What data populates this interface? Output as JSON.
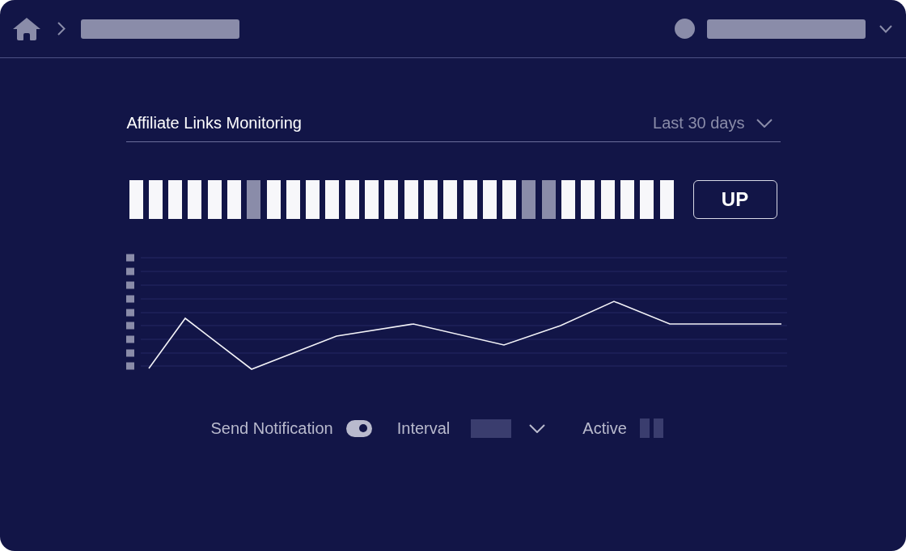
{
  "panel": {
    "title": "Affiliate Links Monitoring",
    "period": "Last 30 days"
  },
  "uptime_bars": [
    {
      "up": true
    },
    {
      "up": true
    },
    {
      "up": true
    },
    {
      "up": true
    },
    {
      "up": true
    },
    {
      "up": true
    },
    {
      "up": false
    },
    {
      "up": true
    },
    {
      "up": true
    },
    {
      "up": true
    },
    {
      "up": true
    },
    {
      "up": true
    },
    {
      "up": true
    },
    {
      "up": true
    },
    {
      "up": true
    },
    {
      "up": true
    },
    {
      "up": true
    },
    {
      "up": true
    },
    {
      "up": true
    },
    {
      "up": true
    },
    {
      "up": false
    },
    {
      "up": false
    },
    {
      "up": true
    },
    {
      "up": true
    },
    {
      "up": true
    },
    {
      "up": true
    },
    {
      "up": true
    },
    {
      "up": true
    }
  ],
  "status_button": {
    "label": "UP"
  },
  "controls": [
    {
      "kind": "toggle",
      "label": "Send Notification",
      "on": true
    },
    {
      "kind": "dropdown",
      "label": "Interval"
    },
    {
      "kind": "indicator",
      "label": "Active"
    }
  ]
}
